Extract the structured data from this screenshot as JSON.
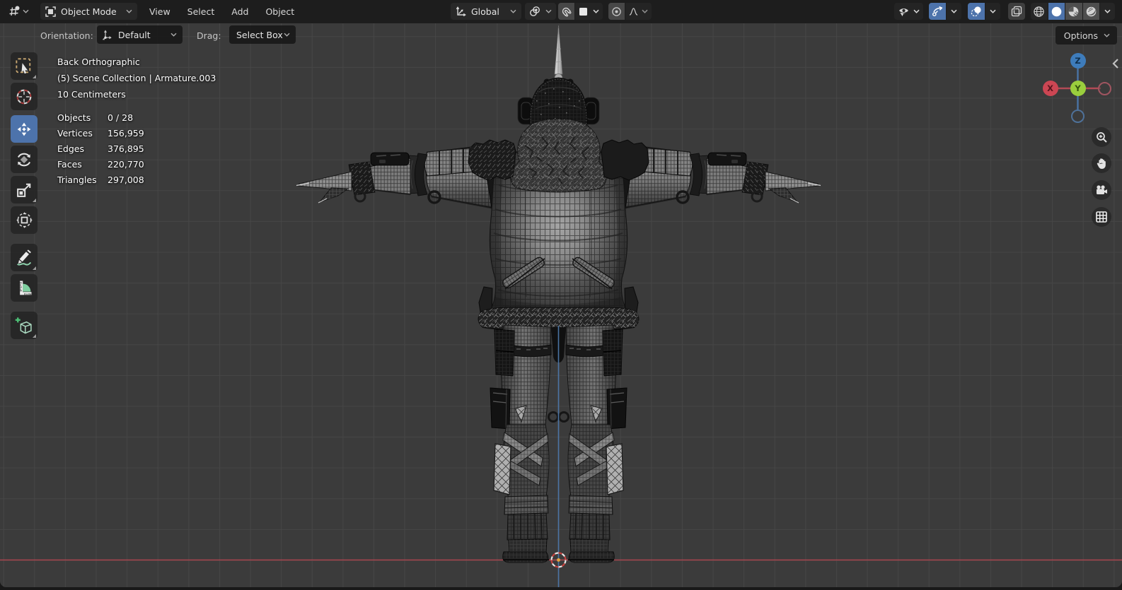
{
  "app": "Blender 3D Viewport",
  "header": {
    "editor_type_icon": "3d-viewport-editor-icon",
    "mode_selector": {
      "icon": "object-mode-icon",
      "label": "Object Mode"
    },
    "menus": [
      {
        "label": "View"
      },
      {
        "label": "Select"
      },
      {
        "label": "Add"
      },
      {
        "label": "Object"
      }
    ],
    "transform_orientation": {
      "icon": "orientation-axes-icon",
      "label": "Global"
    },
    "pivot_point": {
      "icon": "pivot-point-icon"
    },
    "snapping": {
      "toggle_icon": "magnet-icon",
      "snap_to_icon": "increment-snap-icon"
    },
    "proportional_editing": {
      "toggle_icon": "proportional-circle-icon",
      "falloff_icon": "falloff-curve-icon"
    },
    "right_controls": {
      "visibility_icon": "show-object-types-icon",
      "gizmo_toggle_icon": "viewport-gizmos-icon",
      "overlays_toggle_icon": "show-overlays-icon",
      "xray_icon": "toggle-xray-icon",
      "shading": [
        {
          "name": "wireframe",
          "active": false
        },
        {
          "name": "solid",
          "active": true
        },
        {
          "name": "material-preview",
          "active": false
        },
        {
          "name": "rendered",
          "active": false
        }
      ]
    }
  },
  "tool_settings": {
    "orientation_label": "Orientation:",
    "orientation_value": "Default",
    "drag_label": "Drag:",
    "drag_value": "Select Box",
    "options_label": "Options"
  },
  "toolbar": {
    "active_tool": "move",
    "tools": [
      {
        "name": "select-box"
      },
      {
        "name": "cursor"
      },
      {
        "name": "move"
      },
      {
        "name": "rotate"
      },
      {
        "name": "scale"
      },
      {
        "name": "transform"
      },
      {
        "name": "annotate"
      },
      {
        "name": "measure"
      },
      {
        "name": "add-cube"
      }
    ]
  },
  "viewport": {
    "view_name": "Back Orthographic",
    "collection_info": "(5) Scene Collection | Armature.003",
    "grid_scale": "10 Centimeters",
    "stats": [
      {
        "label": "Objects",
        "value": "0 / 28"
      },
      {
        "label": "Vertices",
        "value": "156,959"
      },
      {
        "label": "Edges",
        "value": "376,895"
      },
      {
        "label": "Faces",
        "value": "220,770"
      },
      {
        "label": "Triangles",
        "value": "297,008"
      }
    ],
    "axis_gizmo": {
      "x_label": "X",
      "y_label": "Y",
      "z_label": "Z"
    },
    "nav_buttons": [
      "zoom",
      "pan-hand",
      "camera-view",
      "orthographic-grid"
    ]
  },
  "colors": {
    "accent_blue": "#4d73ab",
    "axis_x_red": "#a8454e",
    "axis_z_blue": "#4d78aa",
    "gizmo_x": "#cc4653",
    "gizmo_y": "#9ace3d",
    "gizmo_z": "#3e7cbb",
    "viewport_bg": "#3b3b3b",
    "header_bg": "#1d1d1d"
  }
}
